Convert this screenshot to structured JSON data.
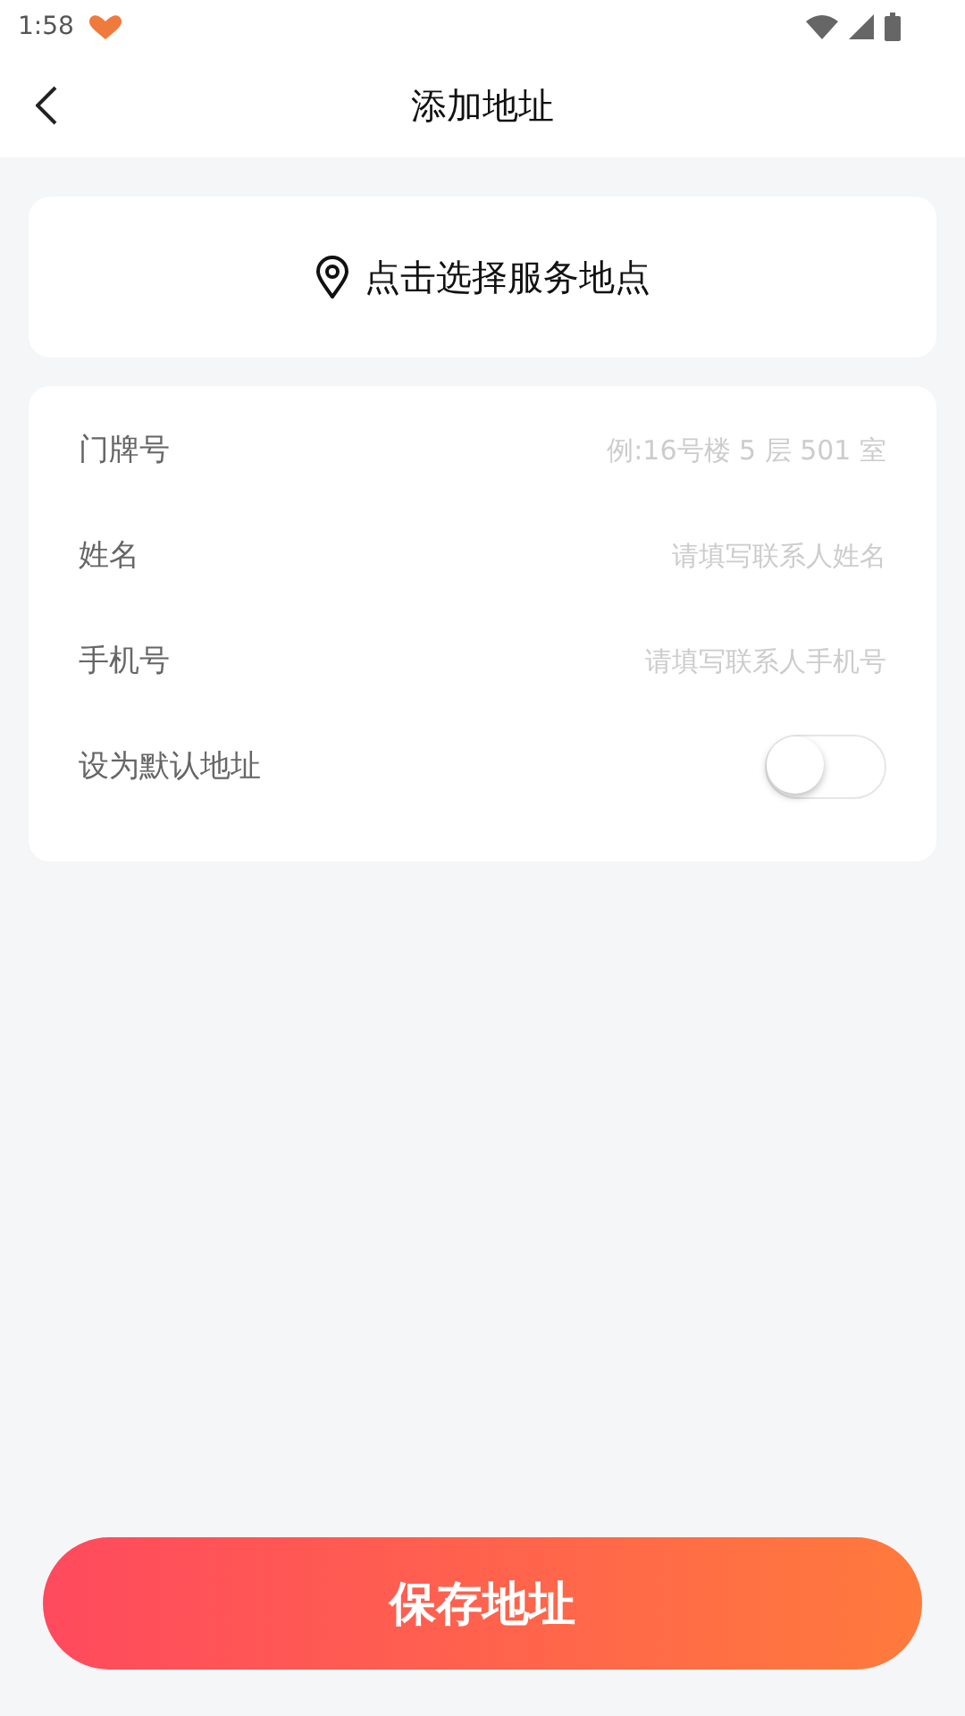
{
  "status_bar": {
    "time": "1:58"
  },
  "header": {
    "title": "添加地址"
  },
  "location_picker": {
    "label": "点击选择服务地点"
  },
  "form": {
    "fields": [
      {
        "label": "门牌号",
        "placeholder": "例:16号楼 5 层 501 室"
      },
      {
        "label": "姓名",
        "placeholder": "请填写联系人姓名"
      },
      {
        "label": "手机号",
        "placeholder": "请填写联系人手机号"
      }
    ],
    "default_toggle": {
      "label": "设为默认地址",
      "on": false
    }
  },
  "save_button": {
    "label": "保存地址"
  }
}
